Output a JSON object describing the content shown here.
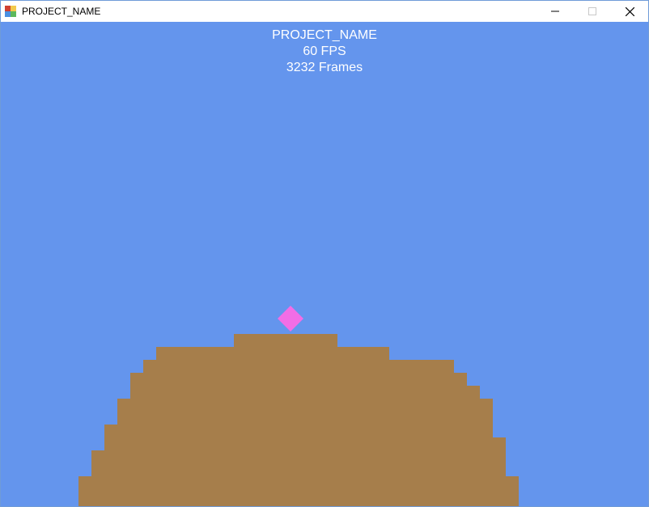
{
  "window": {
    "title": "PROJECT_NAME",
    "icons": {
      "app": "windows-form-icon",
      "minimize": "minimize-icon",
      "maximize": "maximize-icon",
      "close": "close-icon"
    }
  },
  "hud": {
    "project": "PROJECT_NAME",
    "fps": "60 FPS",
    "frames": "3232 Frames"
  },
  "colors": {
    "sky": "#6495ed",
    "ground": "#a67e4b",
    "player": "#f26de6",
    "text": "#ffffff"
  }
}
